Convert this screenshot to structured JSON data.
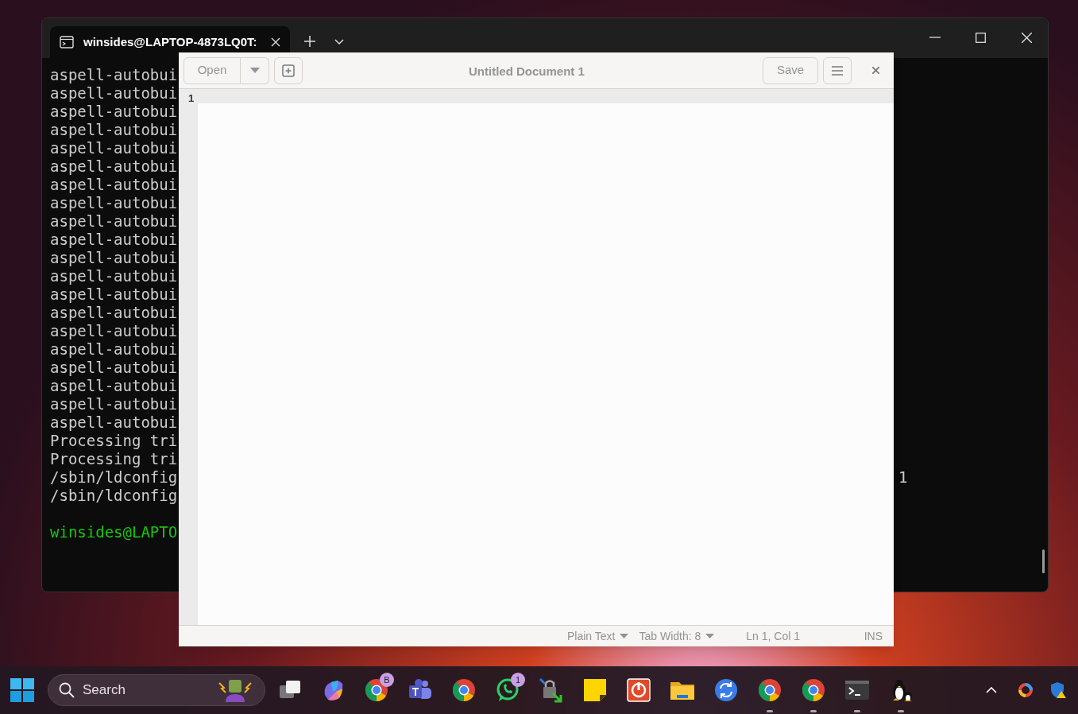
{
  "terminal": {
    "tab_title": "winsides@LAPTOP-4873LQ0T:",
    "lines": [
      {
        "kind": "output",
        "text": "aspell-autobui"
      },
      {
        "kind": "output",
        "text": "aspell-autobui"
      },
      {
        "kind": "output",
        "text": "aspell-autobui"
      },
      {
        "kind": "output",
        "text": "aspell-autobui"
      },
      {
        "kind": "output",
        "text": "aspell-autobui"
      },
      {
        "kind": "output",
        "text": "aspell-autobui"
      },
      {
        "kind": "output",
        "text": "aspell-autobui"
      },
      {
        "kind": "output",
        "text": "aspell-autobui"
      },
      {
        "kind": "output",
        "text": "aspell-autobui"
      },
      {
        "kind": "output",
        "text": "aspell-autobui"
      },
      {
        "kind": "output",
        "text": "aspell-autobui"
      },
      {
        "kind": "output",
        "text": "aspell-autobui"
      },
      {
        "kind": "output",
        "text": "aspell-autobui"
      },
      {
        "kind": "output",
        "text": "aspell-autobui"
      },
      {
        "kind": "output",
        "text": "aspell-autobui"
      },
      {
        "kind": "output",
        "text": "aspell-autobui"
      },
      {
        "kind": "output",
        "text": "aspell-autobui"
      },
      {
        "kind": "output",
        "text": "aspell-autobui"
      },
      {
        "kind": "output",
        "text": "aspell-autobui"
      },
      {
        "kind": "output",
        "text": "aspell-autobui"
      },
      {
        "kind": "output",
        "text": "Processing tri"
      },
      {
        "kind": "output",
        "text": "Processing tri"
      },
      {
        "kind": "output",
        "text": "/sbin/ldconfig",
        "tail": "1"
      },
      {
        "kind": "output",
        "text": "/sbin/ldconfig"
      },
      {
        "kind": "blank"
      },
      {
        "kind": "prompt",
        "text": "winsides@LAPTO"
      }
    ]
  },
  "editor": {
    "open_button": "Open",
    "title": "Untitled Document 1",
    "save_button": "Save",
    "line_numbers": [
      "1"
    ],
    "status_bar": {
      "language": "Plain Text",
      "tab_width": "Tab Width: 8",
      "position": "Ln 1, Col 1",
      "mode": "INS"
    }
  },
  "taskbar": {
    "search_placeholder": "Search",
    "apps": [
      {
        "kind": "taskview",
        "running": false
      },
      {
        "kind": "copilot",
        "running": false
      },
      {
        "kind": "chrome",
        "running": false,
        "badge": "B"
      },
      {
        "kind": "teams",
        "running": false
      },
      {
        "kind": "chrome",
        "running": false
      },
      {
        "kind": "whatsapp",
        "running": false,
        "badge": "1"
      },
      {
        "kind": "lock",
        "running": false
      },
      {
        "kind": "notes",
        "running": false
      },
      {
        "kind": "power",
        "running": false
      },
      {
        "kind": "folder",
        "running": false
      },
      {
        "kind": "sync",
        "running": false
      },
      {
        "kind": "chrome",
        "running": true
      },
      {
        "kind": "chrome",
        "running": true
      },
      {
        "kind": "terminal",
        "running": true
      },
      {
        "kind": "penguin",
        "running": true
      }
    ]
  }
}
